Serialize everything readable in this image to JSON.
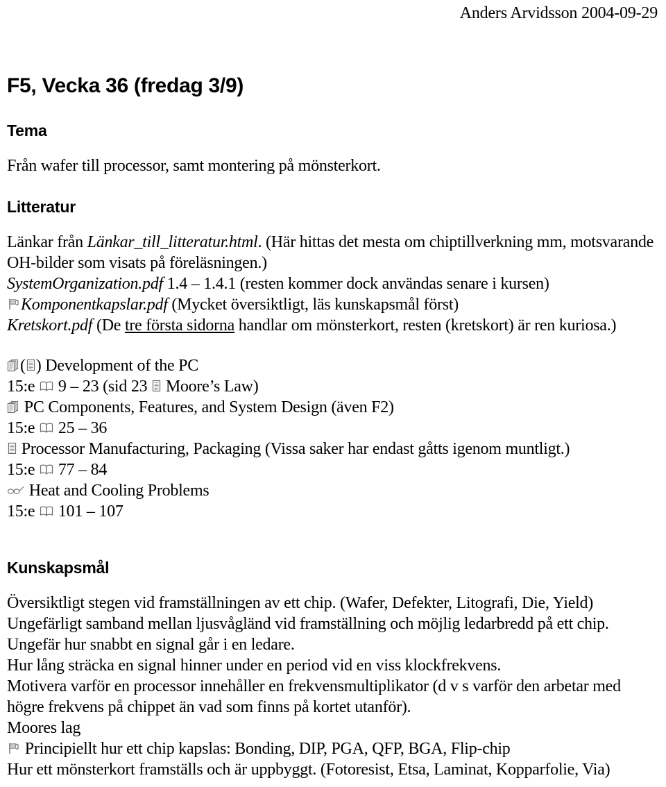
{
  "header": {
    "author_date": "Anders Arvidsson 2004-09-29"
  },
  "title": "F5, Vecka 36 (fredag 3/9)",
  "sections": {
    "tema": {
      "heading": "Tema",
      "text": "Från wafer till processor, samt montering på mönsterkort."
    },
    "litteratur": {
      "heading": "Litteratur",
      "intro_prefix": "Länkar från ",
      "intro_file": "Länkar_till_litteratur.html",
      "intro_suffix": ". (Här hittas det mesta om chiptillverkning mm, motsvarande OH-bilder som visats på föreläsningen.)",
      "refs": [
        {
          "icon": "",
          "file": "SystemOrganization.pdf",
          "rest": " 1.4 – 1.4.1 (resten kommer dock användas senare i kursen)"
        },
        {
          "icon": "flag-icon",
          "file": "Komponentkapslar.pdf",
          "rest": " (Mycket översiktligt, läs kunskapsmål först)"
        },
        {
          "icon": "",
          "file": "Kretskort.pdf",
          "rest_before": " (De ",
          "rest_underlined": "tre första sidorna",
          "rest_after": " handlar om mönsterkort, resten (kretskort) är ren kuriosa.)"
        }
      ],
      "book_entries": [
        {
          "icon": "stacked-pages-icon",
          "icon2": "single-page-icon",
          "topic_before": "(",
          "topic_after": ") Development of the PC",
          "pages_label": "15:e",
          "pages_icon": "open-book-icon",
          "pages": "9 – 23 (sid 23",
          "pages_inline_icon": "single-page-icon",
          "pages_tail": "Moore’s Law)"
        },
        {
          "icon": "stacked-pages-icon",
          "topic": "PC Components, Features, and System Design (även F2)",
          "pages_label": "15:e",
          "pages_icon": "open-book-icon",
          "pages": "25 – 36"
        },
        {
          "icon": "single-page-icon",
          "topic": "Processor Manufacturing, Packaging (Vissa saker har endast gåtts igenom muntligt.)",
          "pages_label": "15:e",
          "pages_icon": "open-book-icon",
          "pages": "77 – 84"
        },
        {
          "icon": "glasses-icon",
          "topic": "Heat and Cooling Problems",
          "pages_label": "15:e",
          "pages_icon": "open-book-icon",
          "pages": "101 – 107"
        }
      ]
    },
    "kunskapsmal": {
      "heading": "Kunskapsmål",
      "goals": [
        "Översiktligt stegen vid framställningen av ett chip. (Wafer, Defekter, Litografi, Die, Yield)",
        "Ungefärligt samband mellan ljusvågländ vid framställning och möjlig ledarbredd på ett chip.",
        "Ungefär hur snabbt en signal går i en ledare.",
        "Hur lång sträcka en signal hinner under en period vid en viss klockfrekvens.",
        "Motivera varför en processor innehåller en frekvensmultiplikator (d v s varför den arbetar med högre frekvens på chippet än vad som finns på kortet utanför).",
        "Moores lag"
      ],
      "goal_flag": {
        "icon": "flag-icon",
        "text": "Principiellt hur ett chip kapslas: Bonding, DIP, PGA, QFP, BGA, Flip-chip"
      },
      "goal_last": "Hur ett mönsterkort framställs och är uppbyggt. (Fotoresist, Etsa, Laminat, Kopparfolie, Via)"
    }
  }
}
